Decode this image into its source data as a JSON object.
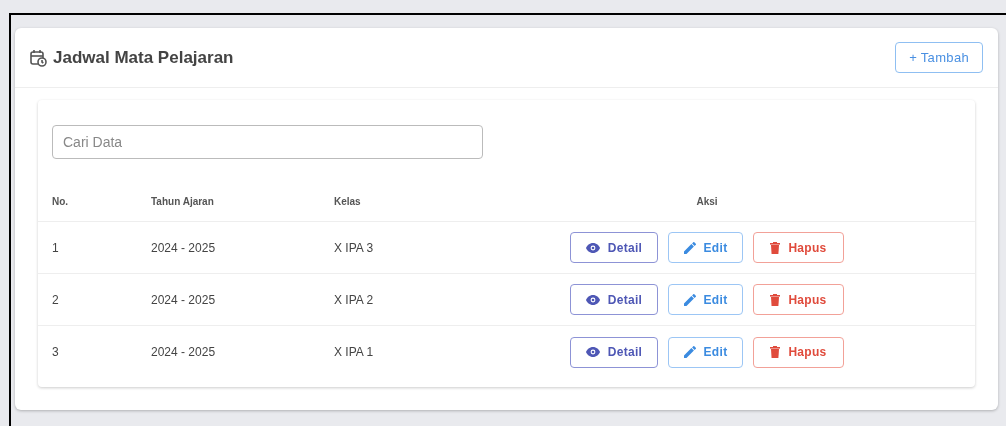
{
  "page": {
    "title": "Jadwal Mata Pelajaran",
    "add_button": "+ Tambah"
  },
  "search": {
    "placeholder": "Cari Data"
  },
  "table": {
    "columns": [
      "No.",
      "Tahun Ajaran",
      "Kelas",
      "Aksi"
    ],
    "rows": [
      {
        "no": "1",
        "year": "2024 - 2025",
        "class": "X IPA 3",
        "actions": [
          {
            "kind": "detail",
            "label": "Detail"
          },
          {
            "kind": "edit",
            "label": "Edit"
          },
          {
            "kind": "delete",
            "label": "Hapus"
          }
        ]
      },
      {
        "no": "2",
        "year": "2024 - 2025",
        "class": "X IPA 2",
        "actions": [
          {
            "kind": "detail",
            "label": "Detail"
          },
          {
            "kind": "edit",
            "label": "Edit"
          },
          {
            "kind": "delete",
            "label": "Hapus"
          }
        ]
      },
      {
        "no": "3",
        "year": "2024 - 2025",
        "class": "X IPA 1",
        "actions": [
          {
            "kind": "detail",
            "label": "Detail"
          },
          {
            "kind": "edit",
            "label": "Edit"
          },
          {
            "kind": "delete",
            "label": "Hapus"
          }
        ]
      }
    ]
  }
}
